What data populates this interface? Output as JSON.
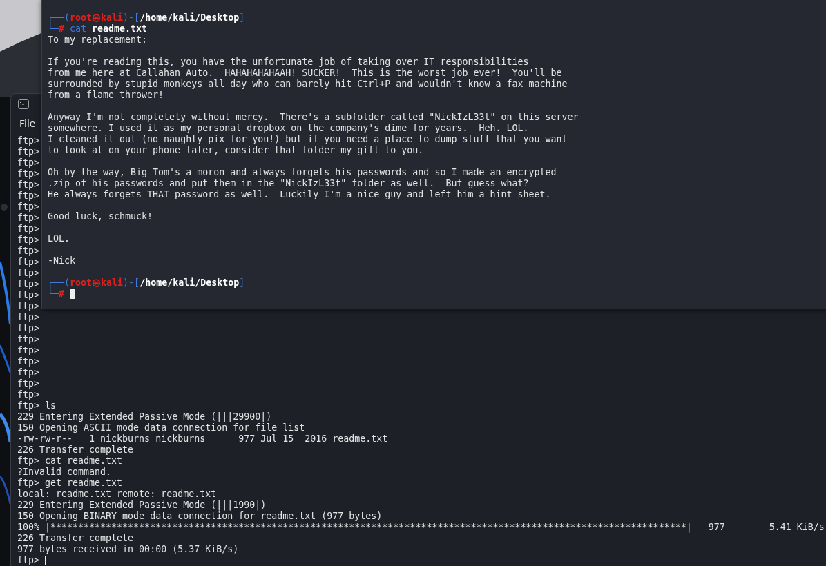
{
  "back_terminal": {
    "menu": [
      {
        "label": "File"
      }
    ],
    "lines": [
      {
        "kind": "text",
        "text": "ftp>"
      },
      {
        "kind": "text",
        "text": "ftp>"
      },
      {
        "kind": "text",
        "text": "ftp>"
      },
      {
        "kind": "text",
        "text": "ftp>"
      },
      {
        "kind": "text",
        "text": "ftp>"
      },
      {
        "kind": "text",
        "text": "ftp>"
      },
      {
        "kind": "text",
        "text": "ftp>"
      },
      {
        "kind": "text",
        "text": "ftp>"
      },
      {
        "kind": "text",
        "text": "ftp>"
      },
      {
        "kind": "text",
        "text": "ftp>"
      },
      {
        "kind": "text",
        "text": "ftp>"
      },
      {
        "kind": "text",
        "text": "ftp>"
      },
      {
        "kind": "text",
        "text": "ftp>"
      },
      {
        "kind": "text",
        "text": "ftp>"
      },
      {
        "kind": "text",
        "text": "ftp>"
      },
      {
        "kind": "text",
        "text": "ftp>"
      },
      {
        "kind": "text",
        "text": "ftp>"
      },
      {
        "kind": "text",
        "text": "ftp>"
      },
      {
        "kind": "text",
        "text": "ftp>"
      },
      {
        "kind": "text",
        "text": "ftp>"
      },
      {
        "kind": "text",
        "text": "ftp>"
      },
      {
        "kind": "text",
        "text": "ftp>"
      },
      {
        "kind": "text",
        "text": "ftp>"
      },
      {
        "kind": "text",
        "text": "ftp>"
      },
      {
        "kind": "text",
        "text": "ftp> ls"
      },
      {
        "kind": "text",
        "text": "229 Entering Extended Passive Mode (|||29900|)"
      },
      {
        "kind": "text",
        "text": "150 Opening ASCII mode data connection for file list"
      },
      {
        "kind": "text",
        "text": "-rw-rw-r--   1 nickburns nickburns      977 Jul 15  2016 readme.txt"
      },
      {
        "kind": "text",
        "text": "226 Transfer complete"
      },
      {
        "kind": "text",
        "text": "ftp> cat readme.txt"
      },
      {
        "kind": "text",
        "text": "?Invalid command."
      },
      {
        "kind": "text",
        "text": "ftp> get readme.txt"
      },
      {
        "kind": "text",
        "text": "local: readme.txt remote: readme.txt"
      },
      {
        "kind": "text",
        "text": "229 Entering Extended Passive Mode (|||1990|)"
      },
      {
        "kind": "text",
        "text": "150 Opening BINARY mode data connection for readme.txt (977 bytes)"
      },
      {
        "kind": "text",
        "text": "100% |*******************************************************************************************************************|   977        5.41 KiB/s"
      },
      {
        "kind": "text",
        "text": "226 Transfer complete"
      },
      {
        "kind": "text",
        "text": "977 bytes received in 00:00 (5.37 KiB/s)"
      },
      {
        "kind": "input",
        "text": "ftp>",
        "focused": false
      }
    ]
  },
  "front_terminal": {
    "lines": [
      {
        "kind": "prompt",
        "frame_top": "┌──(",
        "user": "root",
        "at": "㉿",
        "host": "kali",
        "mid": ")-[",
        "path": "/home/kali/Desktop",
        "close": "]",
        "frame_bottom": "└─",
        "symbol": "#",
        "command": "cat",
        "args": "readme.txt"
      },
      {
        "kind": "text",
        "text": "To my replacement:"
      },
      {
        "kind": "blank"
      },
      {
        "kind": "text",
        "text": "If you're reading this, you have the unfortunate job of taking over IT responsibilities"
      },
      {
        "kind": "text",
        "text": "from me here at Callahan Auto.  HAHAHAHAHAAH! SUCKER!  This is the worst job ever!  You'll be"
      },
      {
        "kind": "text",
        "text": "surrounded by stupid monkeys all day who can barely hit Ctrl+P and wouldn't know a fax machine"
      },
      {
        "kind": "text",
        "text": "from a flame thrower!"
      },
      {
        "kind": "blank"
      },
      {
        "kind": "text",
        "text": "Anyway I'm not completely without mercy.  There's a subfolder called \"NickIzL33t\" on this server"
      },
      {
        "kind": "text",
        "text": "somewhere. I used it as my personal dropbox on the company's dime for years.  Heh. LOL."
      },
      {
        "kind": "text",
        "text": "I cleaned it out (no naughty pix for you!) but if you need a place to dump stuff that you want"
      },
      {
        "kind": "text",
        "text": "to look at on your phone later, consider that folder my gift to you."
      },
      {
        "kind": "blank"
      },
      {
        "kind": "text",
        "text": "Oh by the way, Big Tom's a moron and always forgets his passwords and so I made an encrypted"
      },
      {
        "kind": "text",
        "text": ".zip of his passwords and put them in the \"NickIzL33t\" folder as well.  But guess what?"
      },
      {
        "kind": "text",
        "text": "He always forgets THAT password as well.  Luckily I'm a nice guy and left him a hint sheet."
      },
      {
        "kind": "blank"
      },
      {
        "kind": "text",
        "text": "Good luck, schmuck!"
      },
      {
        "kind": "blank"
      },
      {
        "kind": "text",
        "text": "LOL."
      },
      {
        "kind": "blank"
      },
      {
        "kind": "text",
        "text": "-Nick"
      },
      {
        "kind": "blank"
      },
      {
        "kind": "prompt",
        "frame_top": "┌──(",
        "user": "root",
        "at": "㉿",
        "host": "kali",
        "mid": ")-[",
        "path": "/home/kali/Desktop",
        "close": "]",
        "frame_bottom": "└─",
        "symbol": "#",
        "focused": true
      }
    ]
  }
}
